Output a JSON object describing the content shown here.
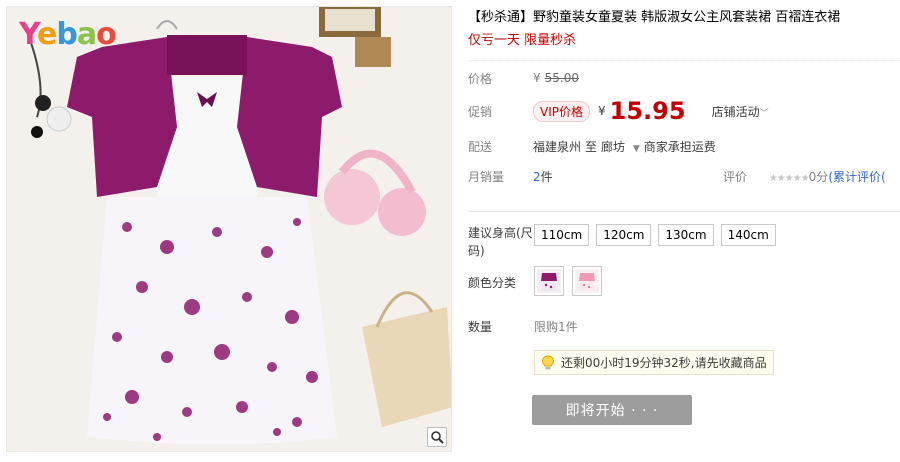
{
  "image": {
    "brand_logo_text": "Yebao",
    "zoom_icon": "magnifier-icon"
  },
  "product": {
    "title": "【秒杀通】野豹童装女童夏装 韩版淑女公主风套装裙 百褶连衣裙",
    "subtitle": "仅亏一天 限量秒杀"
  },
  "price": {
    "label": "价格",
    "currency": "¥",
    "original": "55.00",
    "promo_label": "促销",
    "vip_badge": "VIP价格",
    "promo_currency": "¥",
    "promo_price": "15.95",
    "shop_activity": "店铺活动"
  },
  "shipping": {
    "label": "配送",
    "origin": "福建泉州",
    "to": "至",
    "destination": "廊坊",
    "fee": "商家承担运费"
  },
  "sales": {
    "label": "月销量",
    "count": "2",
    "unit": "件",
    "rating_label": "评价",
    "stars": "★★★★★",
    "score": "0分",
    "review_link": "(累计评价("
  },
  "options": {
    "size_label": "建议身高(尺码)",
    "sizes": [
      "110cm",
      "120cm",
      "130cm",
      "140cm"
    ],
    "color_label": "颜色分类",
    "color_swatches": [
      "purple-dress",
      "pink-dress"
    ],
    "qty_label": "数量",
    "qty_limit": "限购1件"
  },
  "notice": {
    "icon": "bulb-icon",
    "text": "还剩00小时19分钟32秒,请先收藏商品"
  },
  "buy_button": "即将开始 · · ·",
  "colors": {
    "accent_red": "#c40000",
    "button_gray": "#9d9d9d",
    "dress_purple": "#8e1a6c"
  }
}
